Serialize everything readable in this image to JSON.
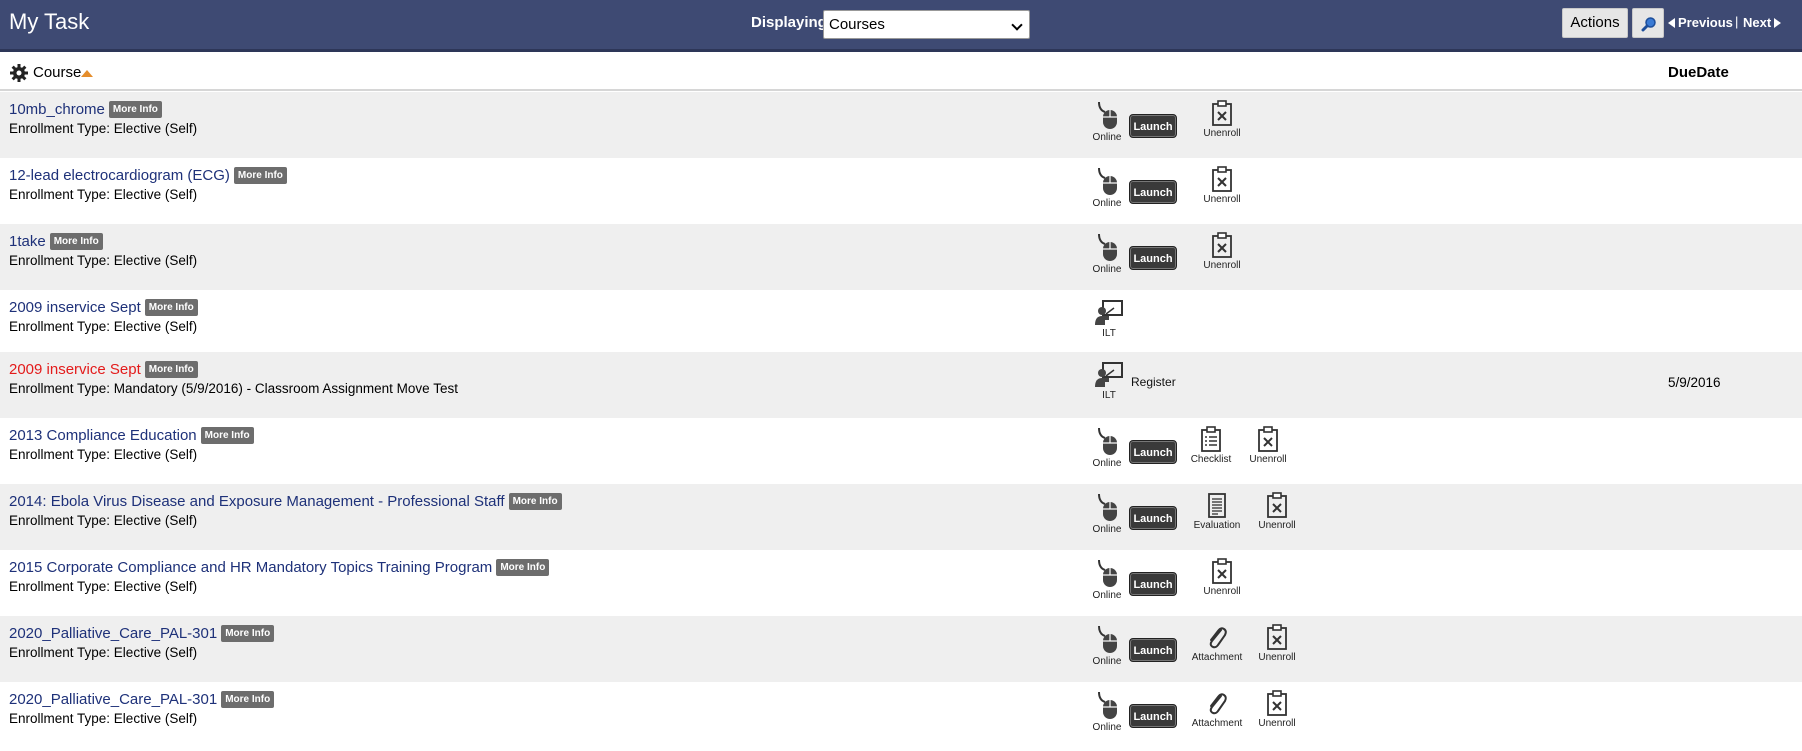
{
  "app": {
    "title": "My Task"
  },
  "toolbar": {
    "displaying_label": "Displaying",
    "display_value": "Courses",
    "actions_label": "Actions",
    "prev_label": "Previous",
    "separator": "|",
    "next_label": "Next"
  },
  "columns": {
    "course": "Course",
    "due": "DueDate"
  },
  "labels": {
    "more_info": "More Info",
    "launch": "Launch",
    "online": "Online",
    "ilt": "ILT",
    "unenroll": "Unenroll",
    "checklist": "Checklist",
    "evaluation": "Evaluation",
    "attachment": "Attachment",
    "register": "Register"
  },
  "courses": [
    {
      "title": "10mb_chrome",
      "enrollment": "Enrollment Type: Elective (Self)",
      "due": ""
    },
    {
      "title": "12-lead electrocardiogram (ECG)",
      "enrollment": "Enrollment Type: Elective (Self)",
      "due": ""
    },
    {
      "title": "1take",
      "enrollment": "Enrollment Type: Elective (Self)",
      "due": ""
    },
    {
      "title": "2009 inservice Sept",
      "enrollment": "Enrollment Type: Elective (Self)",
      "due": ""
    },
    {
      "title": "2009 inservice Sept",
      "enrollment": "Enrollment Type: Mandatory (5/9/2016) - Classroom Assignment Move Test",
      "due": "5/9/2016"
    },
    {
      "title": "2013 Compliance Education",
      "enrollment": "Enrollment Type: Elective (Self)",
      "due": ""
    },
    {
      "title": "2014: Ebola Virus Disease and Exposure Management - Professional Staff",
      "enrollment": "Enrollment Type: Elective (Self)",
      "due": ""
    },
    {
      "title": "2015 Corporate Compliance and HR Mandatory Topics Training Program",
      "enrollment": "Enrollment Type: Elective (Self)",
      "due": ""
    },
    {
      "title": "2020_Palliative_Care_PAL-301",
      "enrollment": "Enrollment Type: Elective (Self)",
      "due": ""
    },
    {
      "title": "2020_Palliative_Care_PAL-301",
      "enrollment": "Enrollment Type: Elective (Self)",
      "due": ""
    }
  ],
  "colors": {
    "header_bg": "#3e4a73",
    "link": "#1e3179",
    "overdue_link": "#e31b1b",
    "sort_arrow": "#e58d2b"
  }
}
